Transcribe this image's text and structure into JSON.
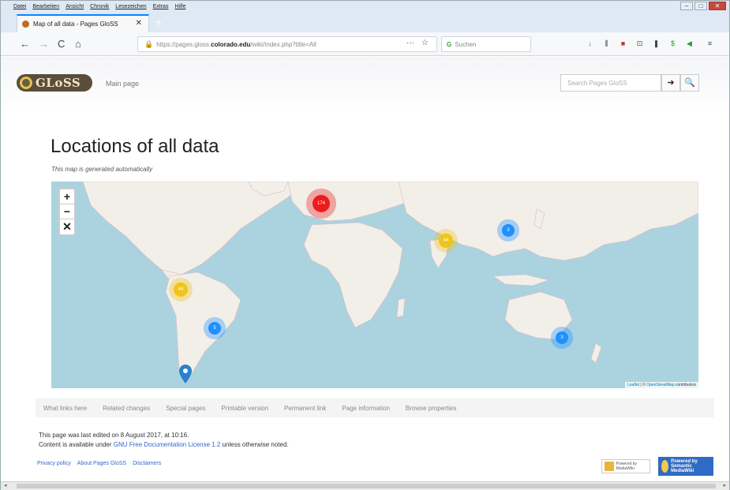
{
  "menubar": [
    "Datei",
    "Bearbeiten",
    "Ansicht",
    "Chronik",
    "Lesezeichen",
    "Extras",
    "Hilfe"
  ],
  "window_buttons": {
    "minimize": "–",
    "maximize": "□",
    "close": "✕"
  },
  "tab": {
    "title": "Map of all data - Pages GloSS",
    "close": "✕",
    "new": "+"
  },
  "nav": {
    "back": "←",
    "forward": "→",
    "reload": "C",
    "home": "⌂"
  },
  "url": {
    "prefix": "https://pages.gloss.",
    "domain": "colorado.edu",
    "suffix": "/wiki/Index.php?title=All",
    "more": "···",
    "bookmark": "☆"
  },
  "search": {
    "engine_icon": "G",
    "placeholder": "Suchen"
  },
  "extensions": [
    "↓",
    "⫼",
    "■",
    "⊡",
    "❚",
    "$",
    "◀",
    "≡"
  ],
  "site": {
    "logo_text": "GLoSS",
    "nav_main": "Main page",
    "search_placeholder": "Search Pages GloSS",
    "go_button": "➜",
    "search_button": "🔍"
  },
  "page": {
    "title": "Locations of all data",
    "subtitle": "This map is generated automatically"
  },
  "map": {
    "zoom_in": "+",
    "zoom_out": "−",
    "fullscreen": "✕",
    "attribution_leaflet": "Leaflet",
    "attribution_sep": " | © ",
    "attribution_osm": "OpenStreetMap",
    "attribution_tail": " contributors",
    "clusters": [
      {
        "label": "174",
        "color": "#ec1c1c",
        "region": "europe"
      },
      {
        "label": "44",
        "color": "#f0c419",
        "region": "south-asia"
      },
      {
        "label": "3",
        "color": "#1e90ff",
        "region": "east-asia"
      },
      {
        "label": "44",
        "color": "#f0c419",
        "region": "northern-south-america"
      },
      {
        "label": "5",
        "color": "#1e90ff",
        "region": "central-south-america"
      },
      {
        "label": "3",
        "color": "#1e90ff",
        "region": "australia"
      }
    ],
    "marker": "southern-tip-south-america"
  },
  "footer_tabs": [
    "What links here",
    "Related changes",
    "Special pages",
    "Printable version",
    "Permanent link",
    "Page information",
    "Browse properties"
  ],
  "footer": {
    "last_edited": "This page was last edited on 8 August 2017, at 10:16.",
    "license_prefix": "Content is available under ",
    "license_link": "GNU Free Documentation License 1.2",
    "license_suffix": " unless otherwise noted.",
    "links": [
      "Privacy policy",
      "About Pages GloSS",
      "Disclaimers"
    ],
    "badge_mediawiki": "Powered by MediaWiki",
    "badge_smw": "Powered by Semantic MediaWiki"
  },
  "scrollbar": {
    "left": "◂",
    "right": "▸"
  }
}
